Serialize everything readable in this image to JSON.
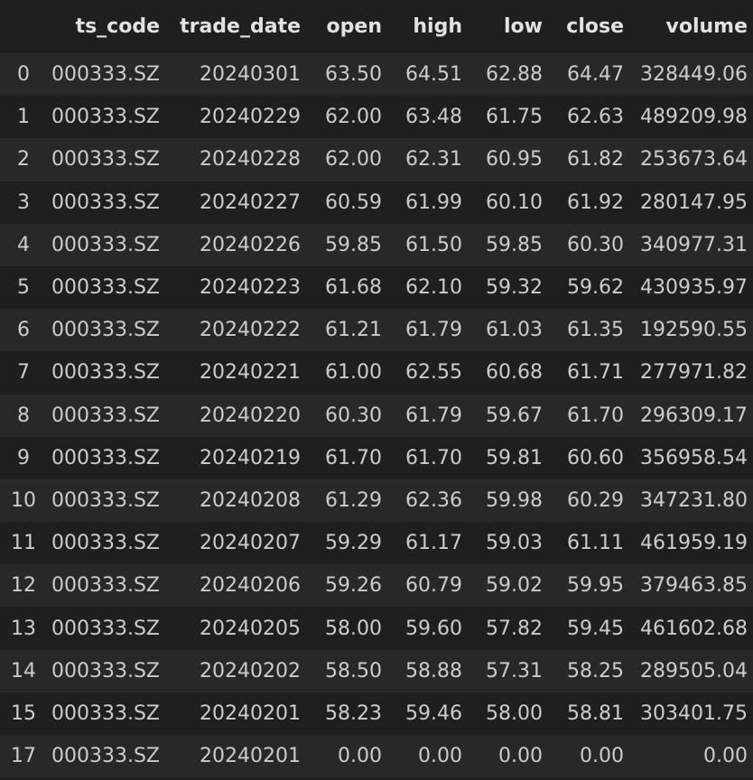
{
  "table": {
    "columns": [
      "",
      "ts_code",
      "trade_date",
      "open",
      "high",
      "low",
      "close",
      "volume"
    ],
    "rows": [
      [
        "0",
        "000333.SZ",
        "20240301",
        "63.50",
        "64.51",
        "62.88",
        "64.47",
        "328449.06"
      ],
      [
        "1",
        "000333.SZ",
        "20240229",
        "62.00",
        "63.48",
        "61.75",
        "62.63",
        "489209.98"
      ],
      [
        "2",
        "000333.SZ",
        "20240228",
        "62.00",
        "62.31",
        "60.95",
        "61.82",
        "253673.64"
      ],
      [
        "3",
        "000333.SZ",
        "20240227",
        "60.59",
        "61.99",
        "60.10",
        "61.92",
        "280147.95"
      ],
      [
        "4",
        "000333.SZ",
        "20240226",
        "59.85",
        "61.50",
        "59.85",
        "60.30",
        "340977.31"
      ],
      [
        "5",
        "000333.SZ",
        "20240223",
        "61.68",
        "62.10",
        "59.32",
        "59.62",
        "430935.97"
      ],
      [
        "6",
        "000333.SZ",
        "20240222",
        "61.21",
        "61.79",
        "61.03",
        "61.35",
        "192590.55"
      ],
      [
        "7",
        "000333.SZ",
        "20240221",
        "61.00",
        "62.55",
        "60.68",
        "61.71",
        "277971.82"
      ],
      [
        "8",
        "000333.SZ",
        "20240220",
        "60.30",
        "61.79",
        "59.67",
        "61.70",
        "296309.17"
      ],
      [
        "9",
        "000333.SZ",
        "20240219",
        "61.70",
        "61.70",
        "59.81",
        "60.60",
        "356958.54"
      ],
      [
        "10",
        "000333.SZ",
        "20240208",
        "61.29",
        "62.36",
        "59.98",
        "60.29",
        "347231.80"
      ],
      [
        "11",
        "000333.SZ",
        "20240207",
        "59.29",
        "61.17",
        "59.03",
        "61.11",
        "461959.19"
      ],
      [
        "12",
        "000333.SZ",
        "20240206",
        "59.26",
        "60.79",
        "59.02",
        "59.95",
        "379463.85"
      ],
      [
        "13",
        "000333.SZ",
        "20240205",
        "58.00",
        "59.60",
        "57.82",
        "59.45",
        "461602.68"
      ],
      [
        "14",
        "000333.SZ",
        "20240202",
        "58.50",
        "58.88",
        "57.31",
        "58.25",
        "289505.04"
      ],
      [
        "15",
        "000333.SZ",
        "20240201",
        "58.23",
        "59.46",
        "58.00",
        "58.81",
        "303401.75"
      ],
      [
        "17",
        "000333.SZ",
        "20240201",
        "0.00",
        "0.00",
        "0.00",
        "0.00",
        "0.00"
      ]
    ]
  },
  "colors": {
    "background": "#1f1f1f",
    "row_stripe": "#282828",
    "text": "#cccccc",
    "header_text": "#e2e2e2"
  }
}
